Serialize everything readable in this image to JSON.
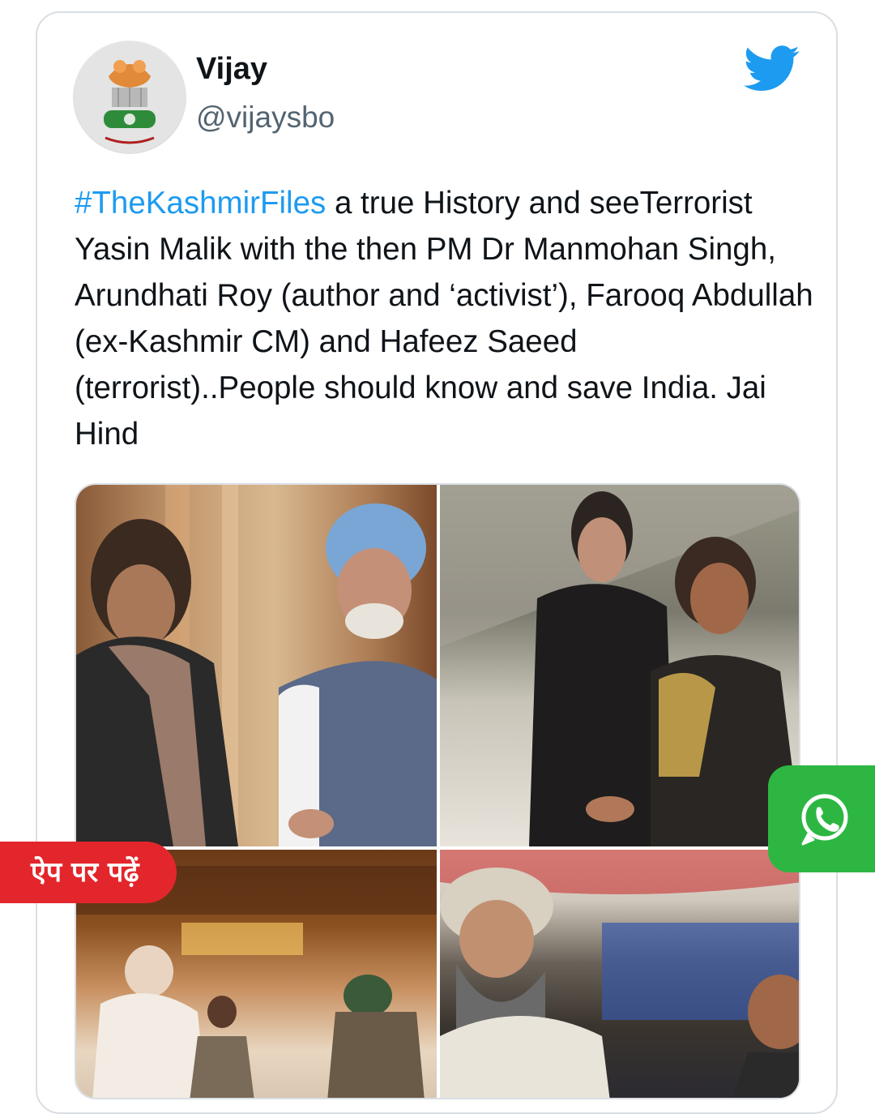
{
  "tweet": {
    "author_name": "Vijay",
    "author_handle": "@vijaysbo",
    "hashtag": "#TheKashmirFiles",
    "body": " a true History and seeTerrorist Yasin Malik with the then PM Dr Manmohan Singh, Arundhati Roy (author and ‘activist’), Farooq Abdullah (ex-Kashmir CM) and Hafeez Saeed (terrorist)..People should know and save India. Jai Hind"
  },
  "overlays": {
    "read_on_app": "ऐप पर पढ़ें",
    "share_icon": "whatsapp-icon"
  },
  "brand": {
    "twitter_blue": "#1d9bf0",
    "whatsapp_green": "#2db742",
    "badge_red": "#e3262b"
  },
  "icons": [
    "twitter-bird-icon",
    "whatsapp-icon",
    "emblem-avatar"
  ]
}
